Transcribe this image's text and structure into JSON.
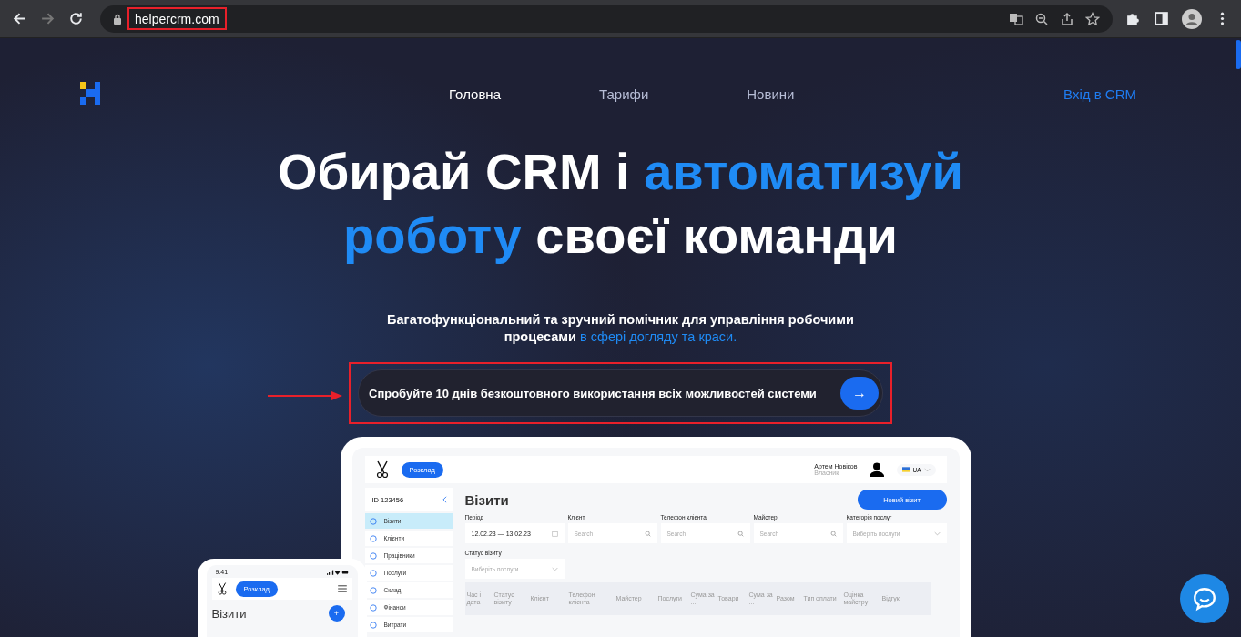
{
  "browser": {
    "url": "helpercrm.com",
    "forward_disabled": true
  },
  "nav": {
    "items": [
      {
        "label": "Головна",
        "selected": true
      },
      {
        "label": "Тарифи",
        "selected": false
      },
      {
        "label": "Новини",
        "selected": false
      }
    ],
    "login": "Вхід в CRM"
  },
  "headline": [
    [
      {
        "text": "Обирай CRM і ",
        "accent": false
      },
      {
        "text": "автоматизуй",
        "accent": true
      }
    ],
    [
      {
        "text": "роботу",
        "accent": true
      },
      {
        "text": " своєї команди",
        "accent": false
      }
    ]
  ],
  "subtitle": [
    {
      "text": "Багатофункціональний та зручний помічник для управління робочими процесами ",
      "accent": false
    },
    {
      "text": "в сфері догляду та краси.",
      "accent": true
    }
  ],
  "cta": {
    "text": "Спробуйте 10 днів безкоштовного використання всіх можливостей системи",
    "arrow": "→"
  },
  "app": {
    "schedule_button": "Розклад",
    "user_name": "Артем Новіков",
    "user_role": "Власник",
    "language": "UA",
    "account_id": "ID 123456",
    "sidebar": [
      {
        "label": "Візити",
        "selected": true
      },
      {
        "label": "Клієнти",
        "selected": false
      },
      {
        "label": "Працівники",
        "selected": false
      },
      {
        "label": "Послуги",
        "selected": false
      },
      {
        "label": "Склад",
        "selected": false
      },
      {
        "label": "Фінанси",
        "selected": false
      },
      {
        "label": "Витрати",
        "selected": false
      }
    ],
    "title": "Візити",
    "new_visit_button": "Новий візит",
    "filters": [
      {
        "label": "Період",
        "kind": "date",
        "value": "12.02.23 — 13.02.23"
      },
      {
        "label": "Клієнт",
        "kind": "search",
        "placeholder": "Search"
      },
      {
        "label": "Телефон клієнта",
        "kind": "search",
        "placeholder": "Search"
      },
      {
        "label": "Майстер",
        "kind": "search",
        "placeholder": "Search"
      },
      {
        "label": "Категорія послуг",
        "kind": "select",
        "placeholder": "Виберіть послуги"
      }
    ],
    "status_filter": {
      "label": "Статус візиту",
      "placeholder": "Виберіть послуги"
    },
    "columns": [
      "Час і дата",
      "Статус візиту",
      "Клієнт",
      "Телефон клієнта",
      "Майстер",
      "Послуги",
      "Сума за ...",
      "Товари",
      "Сума за ...",
      "Разом",
      "Тип оплати",
      "Оцінка майстру",
      "Відгук"
    ]
  },
  "phone": {
    "time": "9:41",
    "schedule_button": "Розклад",
    "title": "Візити",
    "add_button": "+"
  }
}
